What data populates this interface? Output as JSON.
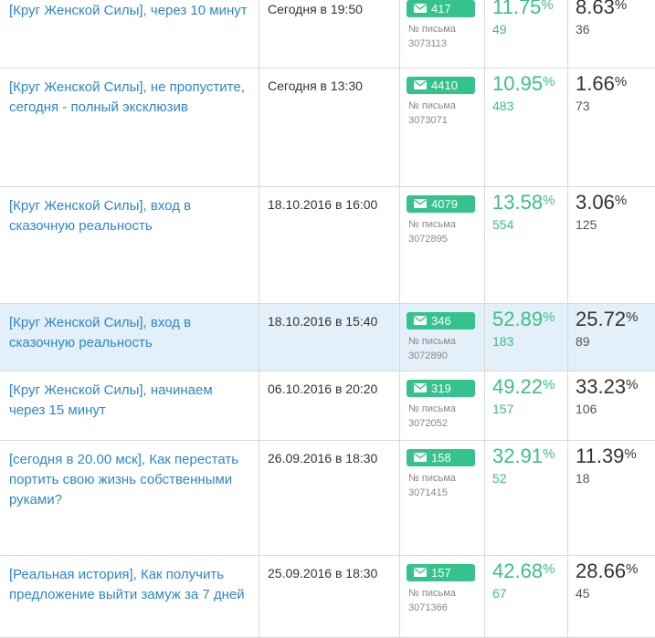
{
  "pct_suffix": "%",
  "msg_label": "№ письма",
  "colors": {
    "link": "#2f87c9",
    "accent": "#36c28d",
    "highlight_row": "#e3eff9"
  },
  "rows": [
    {
      "subject": "[Круг Женской Силы], через 10 минут",
      "date": "Сегодня в 19:50",
      "sent": "417",
      "msg_id": "3073113",
      "open_rate": "11.75",
      "opens": "49",
      "click_rate": "8.63",
      "clicks": "36",
      "highlighted": false
    },
    {
      "subject": "[Круг Женской Силы], не пропустите, сегодня - полный эксклюзив",
      "date": "Сегодня в 13:30",
      "sent": "4410",
      "msg_id": "3073071",
      "open_rate": "10.95",
      "opens": "483",
      "click_rate": "1.66",
      "clicks": "73",
      "highlighted": false
    },
    {
      "subject": "[Круг Женской Силы], вход в сказочную реальность",
      "date": "18.10.2016 в 16:00",
      "sent": "4079",
      "msg_id": "3072895",
      "open_rate": "13.58",
      "opens": "554",
      "click_rate": "3.06",
      "clicks": "125",
      "highlighted": false
    },
    {
      "subject": "[Круг Женской Силы], вход в сказочную реальность",
      "date": "18.10.2016 в 15:40",
      "sent": "346",
      "msg_id": "3072890",
      "open_rate": "52.89",
      "opens": "183",
      "click_rate": "25.72",
      "clicks": "89",
      "highlighted": true
    },
    {
      "subject": "[Круг Женской Силы], начинаем через 15 минут",
      "date": "06.10.2016 в 20:20",
      "sent": "319",
      "msg_id": "3072052",
      "open_rate": "49.22",
      "opens": "157",
      "click_rate": "33.23",
      "clicks": "106",
      "highlighted": false
    },
    {
      "subject": "[сегодня в 20.00 мск], Как перестать портить свою жизнь собственными руками?",
      "date": "26.09.2016 в 18:30",
      "sent": "158",
      "msg_id": "3071415",
      "open_rate": "32.91",
      "opens": "52",
      "click_rate": "11.39",
      "clicks": "18",
      "highlighted": false
    },
    {
      "subject": "[Реальная история], Как получить предложение выйти замуж за 7 дней",
      "date": "25.09.2016 в 18:30",
      "sent": "157",
      "msg_id": "3071366",
      "open_rate": "42.68",
      "opens": "67",
      "click_rate": "28.66",
      "clicks": "45",
      "highlighted": false
    }
  ]
}
